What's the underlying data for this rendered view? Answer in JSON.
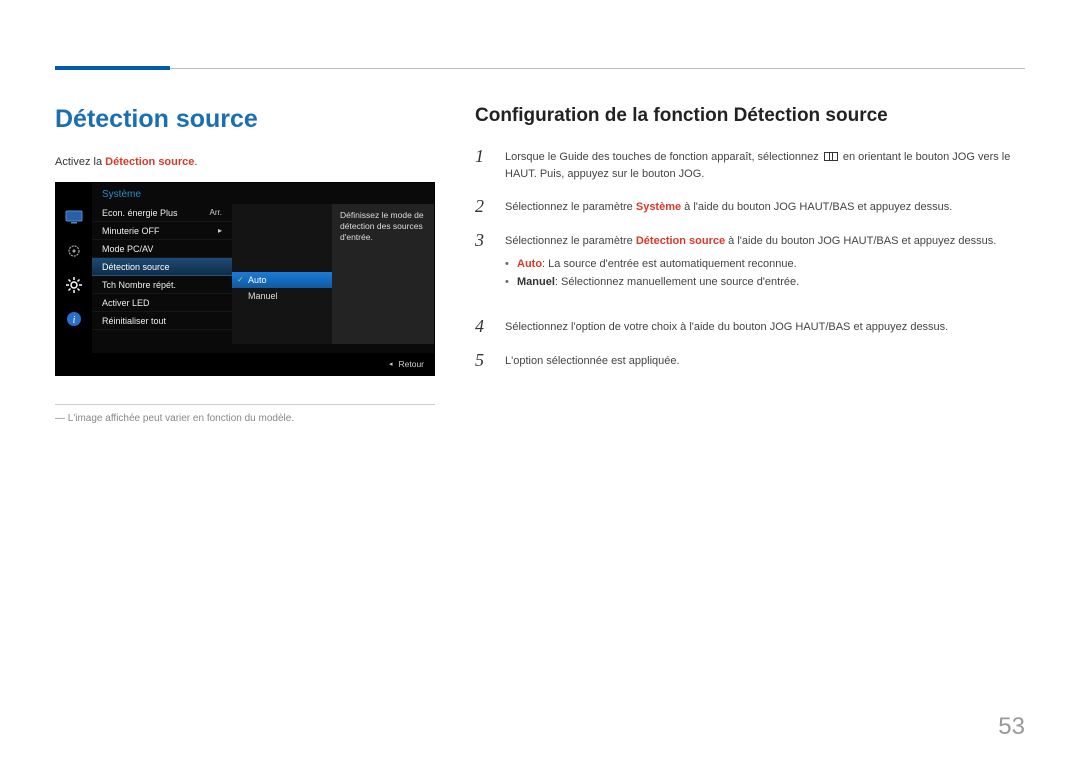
{
  "page_number": "53",
  "section_title": "Détection source",
  "intro": {
    "prefix": "Activez la ",
    "highlight": "Détection source",
    "suffix": "."
  },
  "osd": {
    "header": "Système",
    "items": [
      {
        "label": "Econ. énergie Plus",
        "value": "Arr."
      },
      {
        "label": "Minuterie OFF",
        "value": "▸"
      },
      {
        "label": "Mode PC/AV",
        "value": ""
      },
      {
        "label": "Détection source",
        "value": "",
        "selected": true
      },
      {
        "label": "Tch Nombre répét.",
        "value": ""
      },
      {
        "label": "Activer LED",
        "value": ""
      },
      {
        "label": "Réinitialiser tout",
        "value": ""
      }
    ],
    "sub": [
      {
        "label": "Auto",
        "selected": true
      },
      {
        "label": "Manuel"
      }
    ],
    "desc": "Définissez le mode de détection des sources d'entrée.",
    "footer_label": "Retour"
  },
  "note": "L'image affichée peut varier en fonction du modèle.",
  "config_title": "Configuration de la fonction Détection source",
  "steps": {
    "s1a": "Lorsque le Guide des touches de fonction apparaît, sélectionnez ",
    "s1b": " en orientant le bouton JOG vers le HAUT. Puis, appuyez sur le bouton JOG.",
    "s2a": "Sélectionnez le paramètre ",
    "s2_hl": "Système",
    "s2b": " à l'aide du bouton JOG HAUT/BAS et appuyez dessus.",
    "s3a": "Sélectionnez le paramètre ",
    "s3_hl": "Détection source",
    "s3b": " à l'aide du bouton JOG HAUT/BAS et appuyez dessus.",
    "bullet1_hl": "Auto",
    "bullet1_rest": ": La source d'entrée est automatiquement reconnue.",
    "bullet2_hl": "Manuel",
    "bullet2_rest": ": Sélectionnez manuellement une source d'entrée.",
    "s4": "Sélectionnez l'option de votre choix à l'aide du bouton JOG HAUT/BAS et appuyez dessus.",
    "s5": "L'option sélectionnée est appliquée."
  }
}
